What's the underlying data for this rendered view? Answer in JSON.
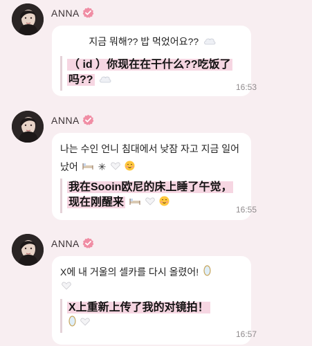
{
  "messages": [
    {
      "sender": "ANNA",
      "text": "지금 뭐해?? 밥 먹었어요??",
      "translation": "（ id ）你现在在干什么??吃饭了吗??",
      "time": "16:53",
      "icons": [
        "cloud-emoji"
      ]
    },
    {
      "sender": "ANNA",
      "text": "나는 수인 언니 침대에서 낮잠 자고 지금 일어났어",
      "translation": "我在Sooin欧尼的床上睡了午觉，现在刚醒来",
      "time": "16:55",
      "icons": [
        "bed-emoji",
        "sparkle-emoji",
        "white-heart-emoji",
        "smile-emoji"
      ]
    },
    {
      "sender": "ANNA",
      "text": "X에 내 거울의 셀카를 다시 올렸어!",
      "translation": "X上重新上传了我的对镜拍！",
      "time": "16:57",
      "icons": [
        "mirror-emoji",
        "white-heart-emoji"
      ]
    }
  ],
  "colors": {
    "background": "#f8eef1",
    "bubble": "#ffffff",
    "highlight": "#f6d6e2",
    "verified": "#f08da4"
  }
}
